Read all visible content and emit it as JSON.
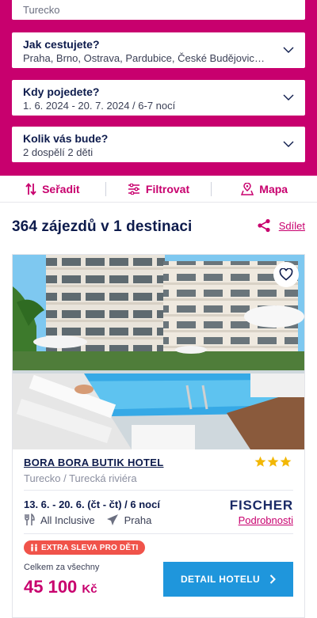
{
  "search": {
    "destination_value": "Turecko",
    "travel_from": {
      "label": "Jak cestujete?",
      "value": "Praha, Brno, Ostrava, Pardubice, České Budějovice, Ka..."
    },
    "dates": {
      "label": "Kdy pojedete?",
      "value": "1. 6. 2024 - 20. 7. 2024 / 6-7 nocí"
    },
    "people": {
      "label": "Kolik vás bude?",
      "value": "2 dospělí 2 děti"
    }
  },
  "toolbar": {
    "sort": "Seřadit",
    "filter": "Filtrovat",
    "map": "Mapa"
  },
  "results": {
    "title": "364 zájezdů v 1 destinaci",
    "share": "Sdílet"
  },
  "hotel": {
    "name": "BORA BORA BUTIK HOTEL",
    "location": "Turecko / Turecká riviéra",
    "stars": 3,
    "dates": "13. 6. - 20. 6. (čt - čt) / 6 nocí",
    "board": "All Inclusive",
    "departure": "Praha",
    "operator": "FISCHER",
    "details_link": "Podrobnosti",
    "badge": "EXTRA SLEVA PRO DĚTI",
    "total_label": "Celkem za všechny",
    "price": "45 100",
    "currency": "Kč",
    "cta": "DETAIL HOTELU"
  },
  "colors": {
    "brand": "#c8006e",
    "navy": "#0d1b4c",
    "cta": "#1f96dc",
    "badge": "#f0534a",
    "star": "#f2b705"
  }
}
